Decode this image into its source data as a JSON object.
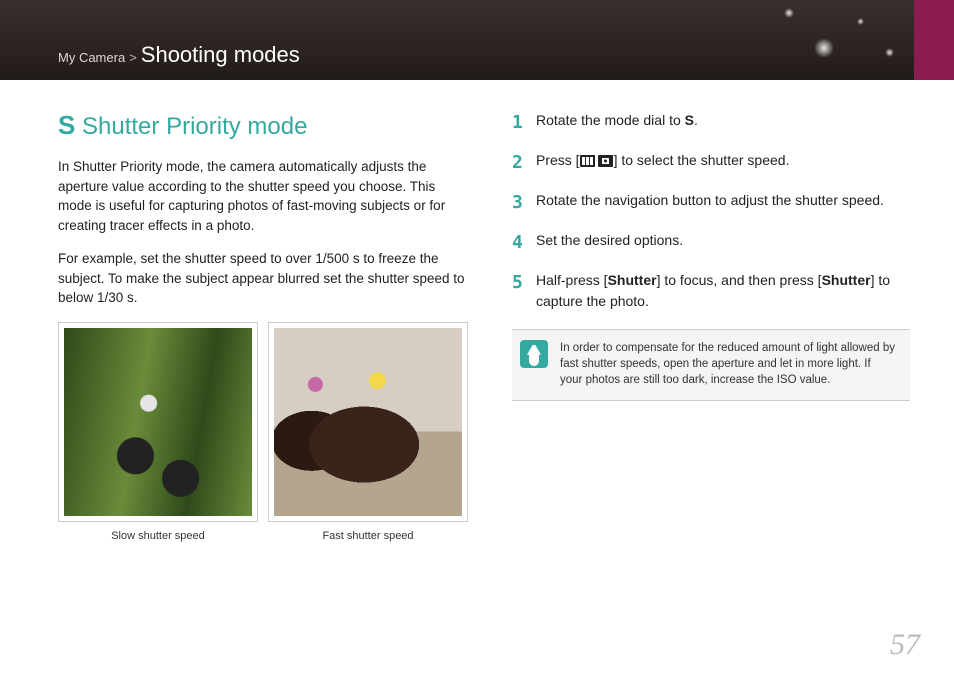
{
  "breadcrumb": {
    "parent": "My Camera",
    "current": "Shooting modes"
  },
  "heading": {
    "prefix": "S",
    "title": "Shutter Priority mode"
  },
  "para1": "In Shutter Priority mode, the camera automatically adjusts the aperture value according to the shutter speed you choose. This mode is useful for capturing photos of fast-moving subjects or for creating tracer effects in a photo.",
  "para2": "For example, set the shutter speed to over 1/500 s to freeze the subject. To make the subject appear blurred set the shutter speed to below 1/30 s.",
  "captions": {
    "slow": "Slow shutter speed",
    "fast": "Fast shutter speed"
  },
  "steps": {
    "s1a": "Rotate the mode dial to ",
    "s1b": "S",
    "s1c": ".",
    "s2a": "Press [",
    "s2b": "] to select the shutter speed.",
    "s3": "Rotate the navigation button to adjust the shutter speed.",
    "s4": "Set the desired options.",
    "s5a": "Half-press [",
    "s5b": "Shutter",
    "s5c": "] to focus, and then press [",
    "s5d": "Shutter",
    "s5e": "] to capture the photo."
  },
  "nums": {
    "n1": "1",
    "n2": "2",
    "n3": "3",
    "n4": "4",
    "n5": "5"
  },
  "note": "In order to compensate for the reduced amount of light allowed by fast shutter speeds, open the aperture and let in more light. If your photos are still too dark, increase the ISO value.",
  "page": "57"
}
